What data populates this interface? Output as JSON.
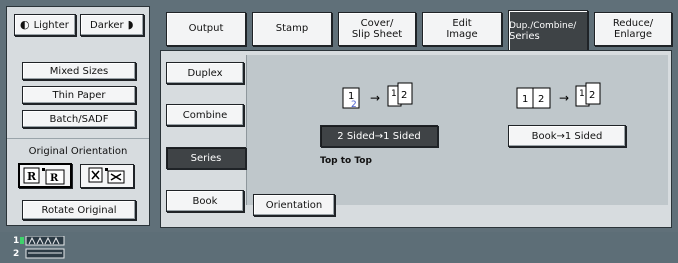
{
  "left_panel": {
    "lighter_label": "Lighter",
    "darker_label": "Darker",
    "mixed_sizes": "Mixed Sizes",
    "thin_paper": "Thin Paper",
    "batch_sadf": "Batch/SADF",
    "original_orientation": "Original Orientation",
    "rotate_original": "Rotate Original"
  },
  "tabs": [
    {
      "label": "Output"
    },
    {
      "label": "Stamp"
    },
    {
      "label_line1": "Cover/",
      "label_line2": "Slip Sheet"
    },
    {
      "label_line1": "Edit",
      "label_line2": "Image"
    },
    {
      "label_line1": "Dup./Combine/",
      "label_line2": "Series"
    },
    {
      "label_line1": "Reduce/",
      "label_line2": "Enlarge"
    }
  ],
  "sub_tabs": {
    "duplex": "Duplex",
    "combine": "Combine",
    "series": "Series",
    "book": "Book"
  },
  "series": {
    "two_sided_to_one": "2 Sided→1 Sided",
    "book_to_one": "Book→1 Sided",
    "top_to_top": "Top to Top",
    "orientation": "Orientation"
  },
  "status": {
    "line1": "1",
    "line2": "2"
  },
  "colors": {
    "panel": "#d7dcdf",
    "content": "#bfc7cb",
    "active": "#3f4346",
    "background": "#5d6e77"
  }
}
